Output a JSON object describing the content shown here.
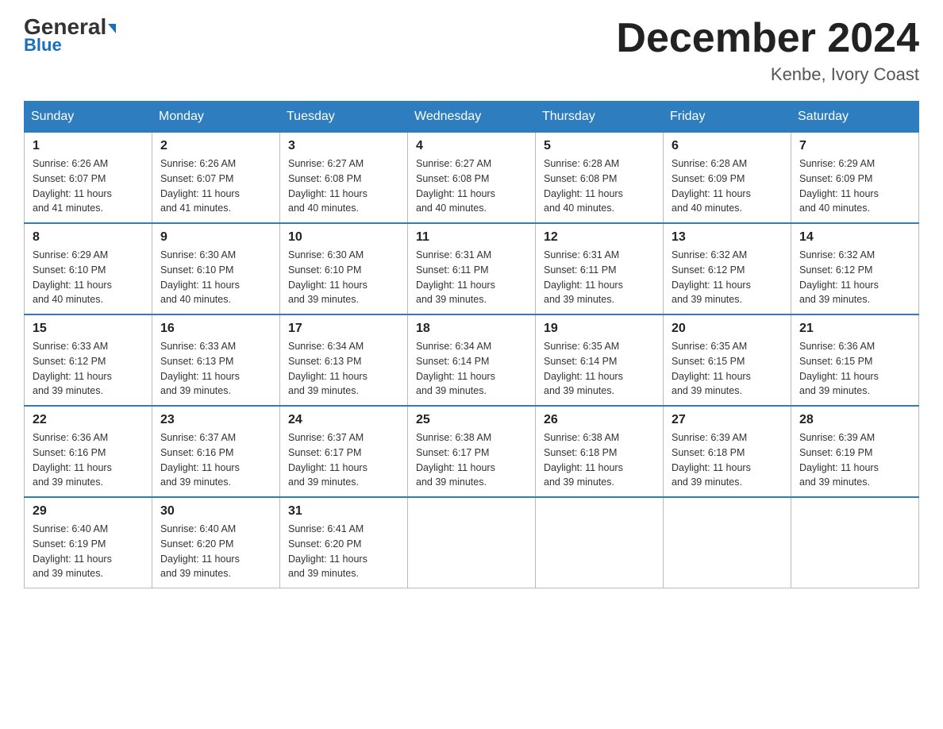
{
  "logo": {
    "line1_part1": "General",
    "line1_part2": "Blue",
    "line2": "Blue"
  },
  "header": {
    "title": "December 2024",
    "location": "Kenbe, Ivory Coast"
  },
  "days_of_week": [
    "Sunday",
    "Monday",
    "Tuesday",
    "Wednesday",
    "Thursday",
    "Friday",
    "Saturday"
  ],
  "weeks": [
    [
      {
        "day": "1",
        "sunrise": "6:26 AM",
        "sunset": "6:07 PM",
        "daylight": "11 hours and 41 minutes."
      },
      {
        "day": "2",
        "sunrise": "6:26 AM",
        "sunset": "6:07 PM",
        "daylight": "11 hours and 41 minutes."
      },
      {
        "day": "3",
        "sunrise": "6:27 AM",
        "sunset": "6:08 PM",
        "daylight": "11 hours and 40 minutes."
      },
      {
        "day": "4",
        "sunrise": "6:27 AM",
        "sunset": "6:08 PM",
        "daylight": "11 hours and 40 minutes."
      },
      {
        "day": "5",
        "sunrise": "6:28 AM",
        "sunset": "6:08 PM",
        "daylight": "11 hours and 40 minutes."
      },
      {
        "day": "6",
        "sunrise": "6:28 AM",
        "sunset": "6:09 PM",
        "daylight": "11 hours and 40 minutes."
      },
      {
        "day": "7",
        "sunrise": "6:29 AM",
        "sunset": "6:09 PM",
        "daylight": "11 hours and 40 minutes."
      }
    ],
    [
      {
        "day": "8",
        "sunrise": "6:29 AM",
        "sunset": "6:10 PM",
        "daylight": "11 hours and 40 minutes."
      },
      {
        "day": "9",
        "sunrise": "6:30 AM",
        "sunset": "6:10 PM",
        "daylight": "11 hours and 40 minutes."
      },
      {
        "day": "10",
        "sunrise": "6:30 AM",
        "sunset": "6:10 PM",
        "daylight": "11 hours and 39 minutes."
      },
      {
        "day": "11",
        "sunrise": "6:31 AM",
        "sunset": "6:11 PM",
        "daylight": "11 hours and 39 minutes."
      },
      {
        "day": "12",
        "sunrise": "6:31 AM",
        "sunset": "6:11 PM",
        "daylight": "11 hours and 39 minutes."
      },
      {
        "day": "13",
        "sunrise": "6:32 AM",
        "sunset": "6:12 PM",
        "daylight": "11 hours and 39 minutes."
      },
      {
        "day": "14",
        "sunrise": "6:32 AM",
        "sunset": "6:12 PM",
        "daylight": "11 hours and 39 minutes."
      }
    ],
    [
      {
        "day": "15",
        "sunrise": "6:33 AM",
        "sunset": "6:12 PM",
        "daylight": "11 hours and 39 minutes."
      },
      {
        "day": "16",
        "sunrise": "6:33 AM",
        "sunset": "6:13 PM",
        "daylight": "11 hours and 39 minutes."
      },
      {
        "day": "17",
        "sunrise": "6:34 AM",
        "sunset": "6:13 PM",
        "daylight": "11 hours and 39 minutes."
      },
      {
        "day": "18",
        "sunrise": "6:34 AM",
        "sunset": "6:14 PM",
        "daylight": "11 hours and 39 minutes."
      },
      {
        "day": "19",
        "sunrise": "6:35 AM",
        "sunset": "6:14 PM",
        "daylight": "11 hours and 39 minutes."
      },
      {
        "day": "20",
        "sunrise": "6:35 AM",
        "sunset": "6:15 PM",
        "daylight": "11 hours and 39 minutes."
      },
      {
        "day": "21",
        "sunrise": "6:36 AM",
        "sunset": "6:15 PM",
        "daylight": "11 hours and 39 minutes."
      }
    ],
    [
      {
        "day": "22",
        "sunrise": "6:36 AM",
        "sunset": "6:16 PM",
        "daylight": "11 hours and 39 minutes."
      },
      {
        "day": "23",
        "sunrise": "6:37 AM",
        "sunset": "6:16 PM",
        "daylight": "11 hours and 39 minutes."
      },
      {
        "day": "24",
        "sunrise": "6:37 AM",
        "sunset": "6:17 PM",
        "daylight": "11 hours and 39 minutes."
      },
      {
        "day": "25",
        "sunrise": "6:38 AM",
        "sunset": "6:17 PM",
        "daylight": "11 hours and 39 minutes."
      },
      {
        "day": "26",
        "sunrise": "6:38 AM",
        "sunset": "6:18 PM",
        "daylight": "11 hours and 39 minutes."
      },
      {
        "day": "27",
        "sunrise": "6:39 AM",
        "sunset": "6:18 PM",
        "daylight": "11 hours and 39 minutes."
      },
      {
        "day": "28",
        "sunrise": "6:39 AM",
        "sunset": "6:19 PM",
        "daylight": "11 hours and 39 minutes."
      }
    ],
    [
      {
        "day": "29",
        "sunrise": "6:40 AM",
        "sunset": "6:19 PM",
        "daylight": "11 hours and 39 minutes."
      },
      {
        "day": "30",
        "sunrise": "6:40 AM",
        "sunset": "6:20 PM",
        "daylight": "11 hours and 39 minutes."
      },
      {
        "day": "31",
        "sunrise": "6:41 AM",
        "sunset": "6:20 PM",
        "daylight": "11 hours and 39 minutes."
      },
      null,
      null,
      null,
      null
    ]
  ],
  "labels": {
    "sunrise": "Sunrise:",
    "sunset": "Sunset:",
    "daylight": "Daylight:"
  }
}
